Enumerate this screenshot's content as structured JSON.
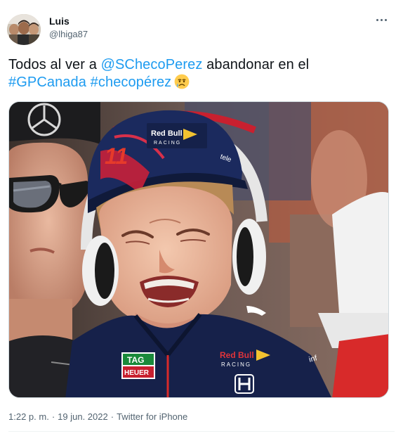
{
  "author": {
    "name": "Luis",
    "handle": "@lhiga87"
  },
  "tweet": {
    "line1_text": "Todos al ver a ",
    "mention": "@SChecoPerez",
    "line1_suffix": " abandonar en el",
    "hashtag1": "#GPCanada",
    "hashtag2": "#checopérez",
    "emoji": "crying-face-emoji"
  },
  "media": {
    "subject": "crying-boy-photo",
    "cap_number": "11",
    "cap_brand": "Red Bull",
    "cap_brand_sub": "RACING",
    "shirt_badge_top": "TAG",
    "shirt_badge_bottom": "HEUER",
    "shirt_brand": "Red Bull",
    "shirt_brand_sub": "RACING"
  },
  "meta": {
    "time": "1:22 p. m.",
    "date": "19 jun. 2022",
    "source": "Twitter for iPhone"
  },
  "colors": {
    "link": "#1d9bf0",
    "secondary_text": "#536471",
    "primary_text": "#0f1419"
  }
}
